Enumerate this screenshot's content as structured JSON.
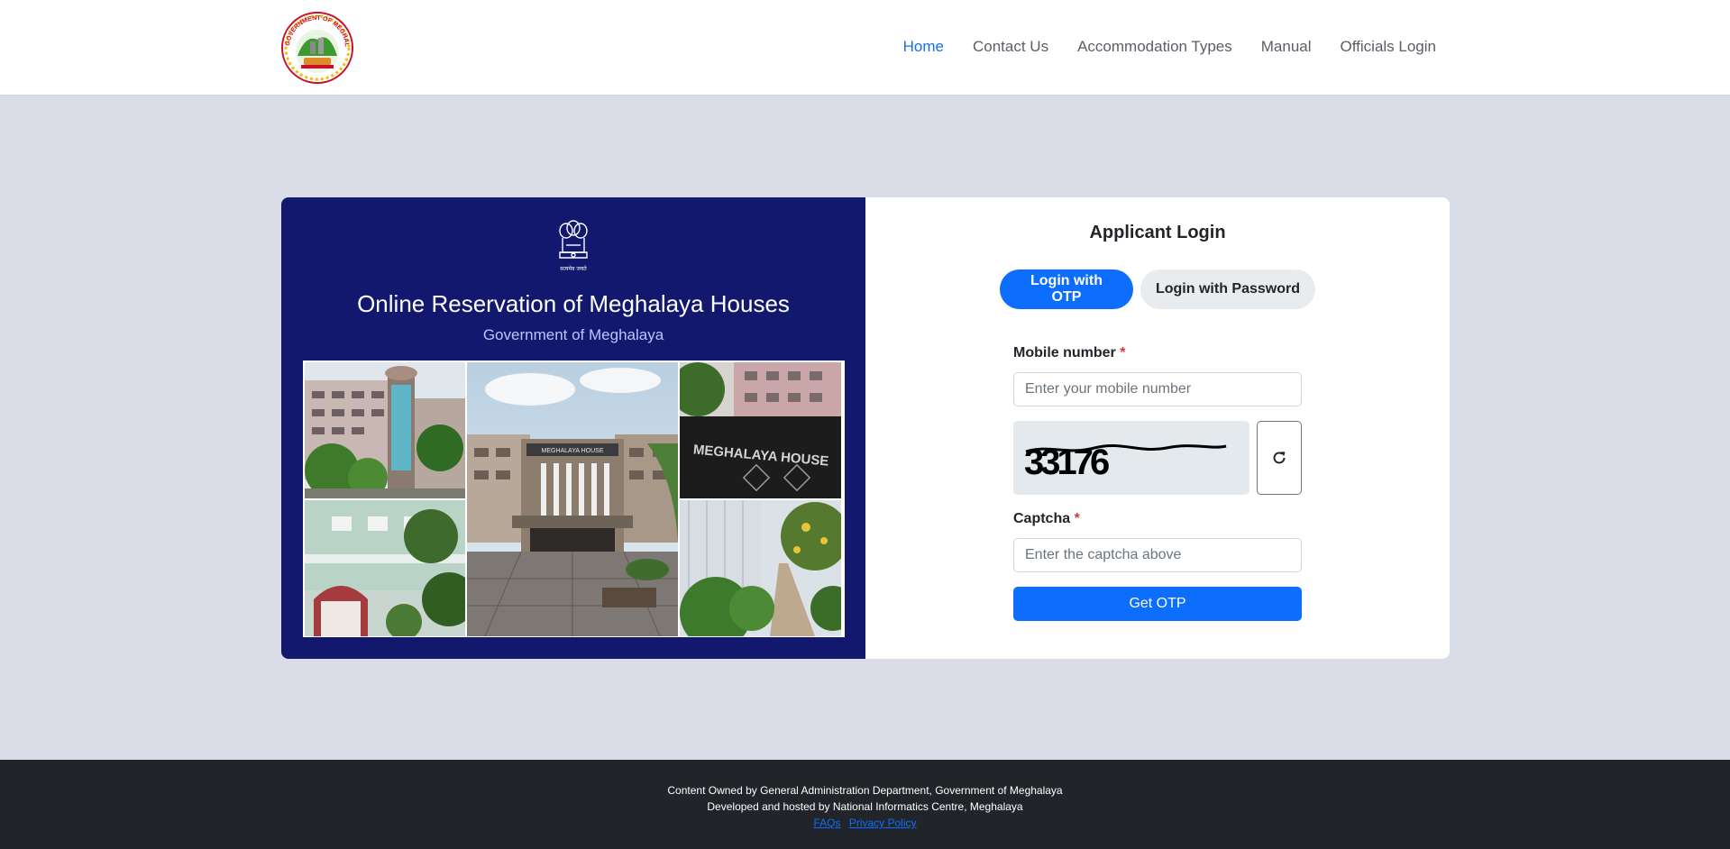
{
  "header": {
    "logo_text": "GOVERNMENT OF MEGHALAYA",
    "nav": [
      {
        "label": "Home",
        "active": true
      },
      {
        "label": "Contact Us",
        "active": false
      },
      {
        "label": "Accommodation Types",
        "active": false
      },
      {
        "label": "Manual",
        "active": false
      },
      {
        "label": "Officials Login",
        "active": false
      }
    ]
  },
  "hero": {
    "emblem_text": "सत्यमेव जयते",
    "title": "Online Reservation of Meghalaya Houses",
    "subtitle": "Government of Meghalaya",
    "photo_sign_text": "MEGHALAYA HOUSE"
  },
  "login": {
    "title": "Applicant Login",
    "tabs": [
      {
        "label": "Login with OTP",
        "active": true
      },
      {
        "label": "Login with Password",
        "active": false
      }
    ],
    "mobile_label": "Mobile number",
    "mobile_placeholder": "Enter your mobile number",
    "mobile_value": "",
    "captcha_code": "33176",
    "captcha_label": "Captcha",
    "captcha_placeholder": "Enter the captcha above",
    "captcha_value": "",
    "required_mark": "*",
    "submit_label": "Get OTP",
    "refresh_icon": "refresh-icon"
  },
  "footer": {
    "line1": "Content Owned by General Administration Department, Government of Meghalaya",
    "line2": "Developed and hosted by National Informatics Centre, Meghalaya",
    "links": [
      "FAQs",
      "Privacy Policy"
    ]
  },
  "colors": {
    "primary": "#0d6efd",
    "hero_background": "#12186d",
    "page_background": "#dadce8",
    "footer_background": "#212529",
    "required": "#dc3545"
  }
}
